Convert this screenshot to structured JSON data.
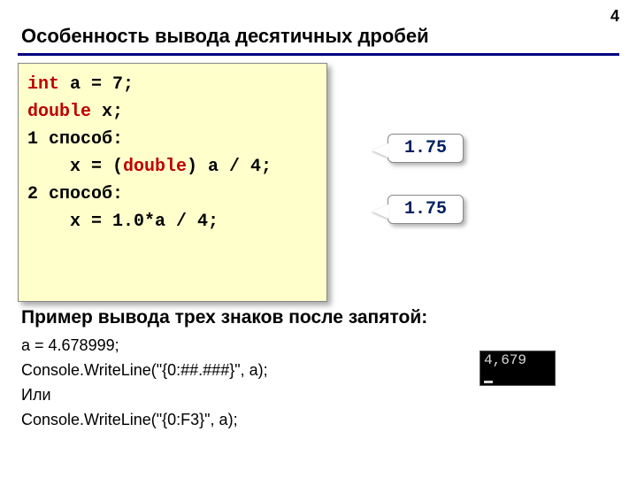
{
  "page_number": "4",
  "title": "Особенность вывода десятичных дробей",
  "code": {
    "line1_kw": "int",
    "line1_rest": " a = 7;",
    "line2_kw": "double",
    "line2_rest": " x;",
    "method1_label": "1 способ:",
    "method1_code_pre": "    x = (",
    "method1_code_kw": "double",
    "method1_code_post": ") a / 4;",
    "method2_label": "2 способ:",
    "method2_code": "    x = 1.0*a / 4;"
  },
  "results": {
    "r1": "1.75",
    "r2": "1.75"
  },
  "subtitle": "Пример вывода трех знаков после запятой:",
  "example": {
    "l1": "a = 4.678999;",
    "l2": "Console.WriteLine(\"{0:##.###}\", a);",
    "l3": "Или",
    "l4": "Console.WriteLine(\"{0:F3}\", a);"
  },
  "console_output": "4,679"
}
